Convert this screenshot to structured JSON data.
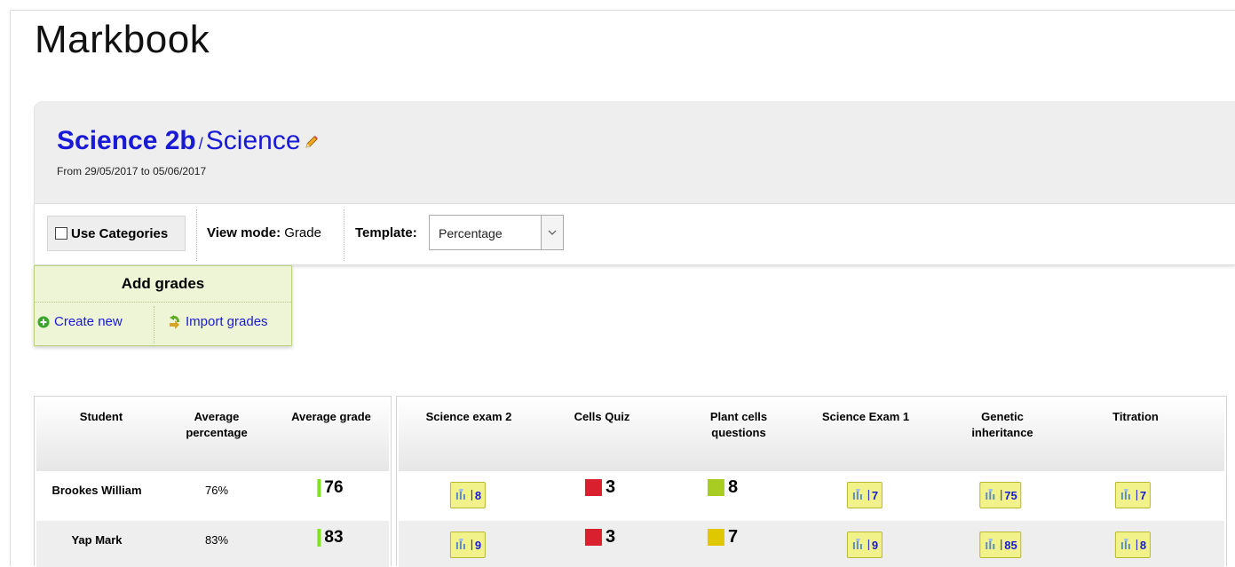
{
  "page": {
    "title": "Markbook"
  },
  "class": {
    "name": "Science 2b",
    "separator": "/",
    "subject": "Science",
    "date_range": "From 29/05/2017 to 05/06/2017"
  },
  "toolbar": {
    "use_categories_label": "Use Categories",
    "view_mode_label": "View mode:",
    "view_mode_value": "Grade",
    "template_label": "Template:",
    "template_value": "Percentage"
  },
  "add_grades": {
    "title": "Add grades",
    "create_new": "Create new",
    "import_grades": "Import grades"
  },
  "summary_table": {
    "headers": [
      "Student",
      "Average\npercentage",
      "Average grade"
    ],
    "rows": [
      {
        "student": "Brookes William",
        "avg_pct": "76%",
        "avg_grade": "76"
      },
      {
        "student": "Yap Mark",
        "avg_pct": "83%",
        "avg_grade": "83"
      }
    ]
  },
  "grades_table": {
    "headers": [
      "Science exam 2",
      "Cells Quiz",
      "Plant cells\nquestions",
      "Science Exam 1",
      "Genetic\ninheritance",
      "Titration"
    ],
    "rows": [
      [
        {
          "type": "btn",
          "value": "8"
        },
        {
          "type": "sq",
          "value": "3",
          "color": "#d9202e"
        },
        {
          "type": "sq",
          "value": "8",
          "color": "#a8cc22"
        },
        {
          "type": "btn",
          "value": "7"
        },
        {
          "type": "btn",
          "value": "75"
        },
        {
          "type": "btn",
          "value": "7"
        }
      ],
      [
        {
          "type": "btn",
          "value": "9"
        },
        {
          "type": "sq",
          "value": "3",
          "color": "#d9202e"
        },
        {
          "type": "sq",
          "value": "7",
          "color": "#e0c800"
        },
        {
          "type": "btn",
          "value": "9"
        },
        {
          "type": "btn",
          "value": "85"
        },
        {
          "type": "btn",
          "value": "8"
        }
      ]
    ]
  },
  "colors": {
    "link": "#1919d8",
    "avg_bar": "#7ee320",
    "add_grades_bg": "#eef5d7",
    "grade_button_bg": "#f2f28a"
  },
  "icons": {
    "edit": "pencil-icon",
    "create": "plus-circle-icon",
    "import": "import-arrow-icon",
    "grade_button": "bar-chart-icon"
  }
}
